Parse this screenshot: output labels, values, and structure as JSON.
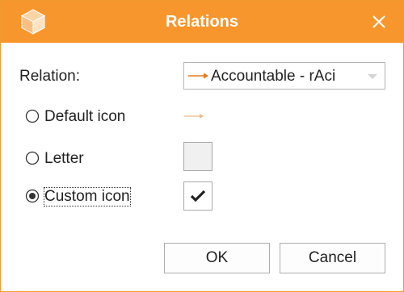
{
  "dialog": {
    "title": "Relations",
    "accent_color": "#f7962c",
    "app_icon": "orange-cube-icon",
    "close_icon": "close-icon"
  },
  "relation": {
    "label": "Relation:",
    "selected_value": "Accountable - rAci",
    "arrow_color": "#e07a1f"
  },
  "options": {
    "default_icon": {
      "label": "Default icon",
      "selected": false
    },
    "letter": {
      "label": "Letter",
      "selected": false
    },
    "custom_icon": {
      "label": "Custom icon",
      "selected": true
    }
  },
  "preview": {
    "default_arrow_color": "#f0b98a",
    "custom_icon": "checkmark-icon"
  },
  "buttons": {
    "ok": "OK",
    "cancel": "Cancel"
  }
}
